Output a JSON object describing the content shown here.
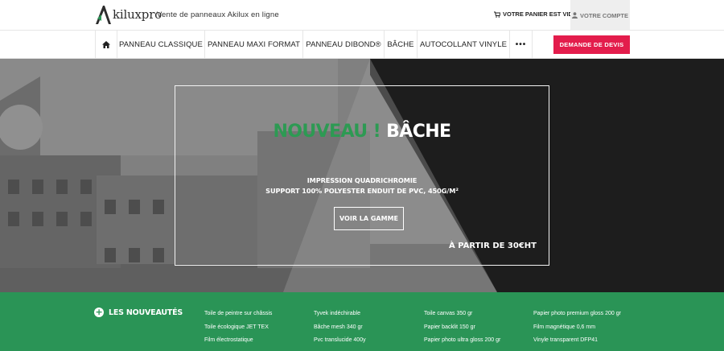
{
  "header": {
    "logo_text": "kiluxpro",
    "logo_letter": "A",
    "tagline": "Vente de panneaux Akilux en ligne",
    "cart_label": "VOTRE PANIER EST VIDE",
    "account_label": "VOTRE COMPTE"
  },
  "nav": {
    "items": [
      {
        "label": "PANNEAU CLASSIQUE"
      },
      {
        "label": "PANNEAU MAXI FORMAT"
      },
      {
        "label": "PANNEAU DIBOND®"
      },
      {
        "label": "BÂCHE"
      },
      {
        "label": "AUTOCOLLANT VINYLE"
      }
    ],
    "more_label": "•••",
    "quote_label": "DEMANDE DE DEVIS"
  },
  "hero": {
    "title_green": "NOUVEAU !",
    "title_white": "BÂCHE",
    "line1": "IMPRESSION QUADRICHROMIE",
    "line2": "SUPPORT 100% POLYESTER ENDUIT DE PVC, 450G/M²",
    "button_label": "VOIR LA GAMME",
    "price": "À PARTIR DE 30€HT"
  },
  "footer": {
    "heading": "LES NOUVEAUTÉS",
    "columns": [
      [
        "Toile de peintre sur châssis",
        "Toile écologique JET TEX",
        "Film électrostatique"
      ],
      [
        "Tyvek indéchirable",
        "Bâche mesh 340 gr",
        "Pvc translucide 400y"
      ],
      [
        "Toile canvas 350 gr",
        "Papier backlit 150 gr",
        "Papier photo ultra gloss 200 gr"
      ],
      [
        "Papier photo premium gloss 200 gr",
        "Film magnétique 0,6 mm",
        "Vinyle transparent DFP41"
      ]
    ]
  },
  "colors": {
    "accent_red": "#e31d4c",
    "brand_green": "#2a9456",
    "title_green": "#2d9a53"
  }
}
